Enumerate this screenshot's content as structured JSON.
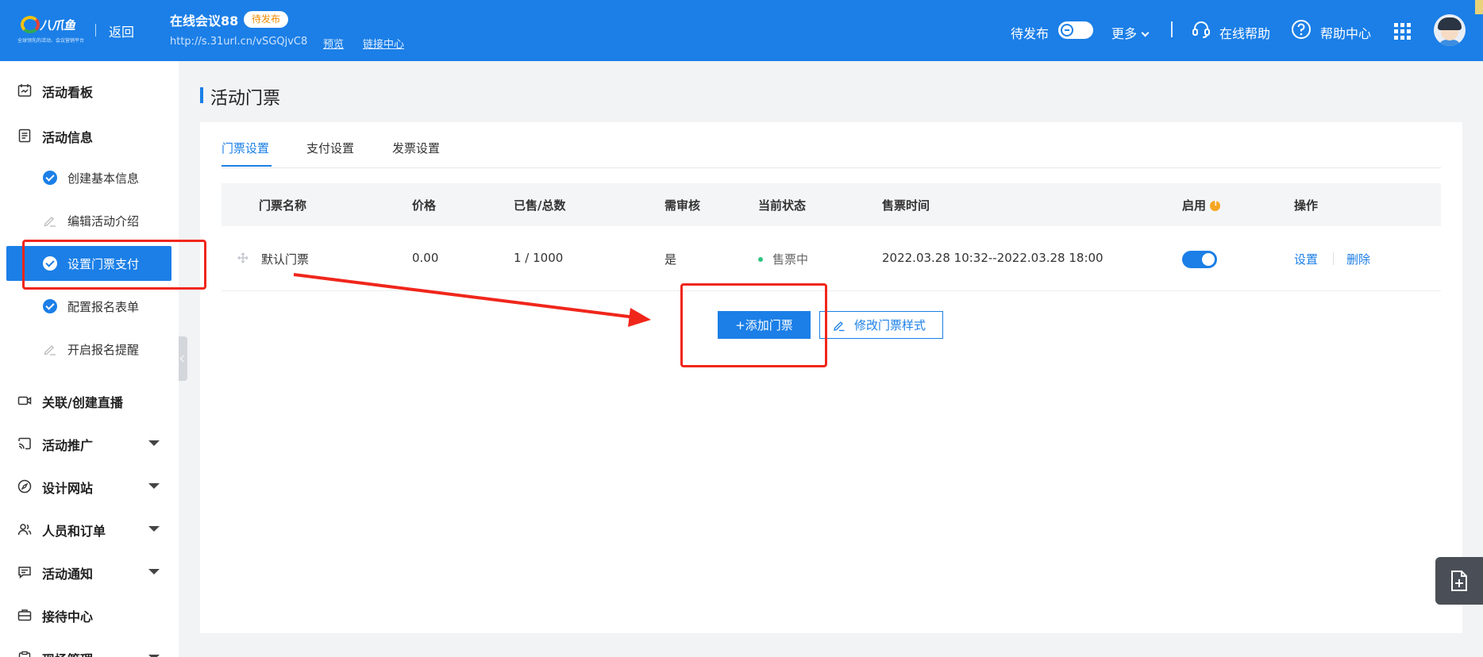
{
  "header": {
    "logo_brand": "八爪鱼",
    "logo_slogan": "全球领先的活动、会议营销平台",
    "back_label": "返回",
    "event_title": "在线会议88",
    "event_status_badge": "待发布",
    "event_url": "http://s.31url.cn/vSGQjvC8",
    "preview_link": "预览",
    "link_center": "链接中心",
    "pending_label": "待发布",
    "more_label": "更多",
    "online_help": "在线帮助",
    "help_center": "帮助中心",
    "accent_color": "#1b7fe7"
  },
  "sidebar": {
    "dashboard": "活动看板",
    "event_info": "活动信息",
    "sub_items": [
      {
        "label": "创建基本信息",
        "state": "done"
      },
      {
        "label": "编辑活动介绍",
        "state": "pending"
      },
      {
        "label": "设置门票支付",
        "state": "active"
      },
      {
        "label": "配置报名表单",
        "state": "done"
      },
      {
        "label": "开启报名提醒",
        "state": "pending"
      }
    ],
    "live": "关联/创建直播",
    "promotion": "活动推广",
    "design_site": "设计网站",
    "people_orders": "人员和订单",
    "notification": "活动通知",
    "reception": "接待中心",
    "onsite": "现场管理"
  },
  "main": {
    "page_title": "活动门票",
    "tabs": [
      "门票设置",
      "支付设置",
      "发票设置"
    ],
    "active_tab": "门票设置",
    "columns": [
      "门票名称",
      "价格",
      "已售/总数",
      "需审核",
      "当前状态",
      "售票时间",
      "启用",
      "操作"
    ],
    "rows": [
      {
        "name": "默认门票",
        "price": "0.00",
        "sold_total": "1 / 1000",
        "review": "是",
        "status": "售票中",
        "sale_time": "2022.03.28 10:32--2022.03.28 18:00",
        "enabled": true,
        "actions": [
          "设置",
          "删除"
        ]
      }
    ],
    "add_ticket_button": "+添加门票",
    "edit_style_button": "修改门票样式"
  }
}
